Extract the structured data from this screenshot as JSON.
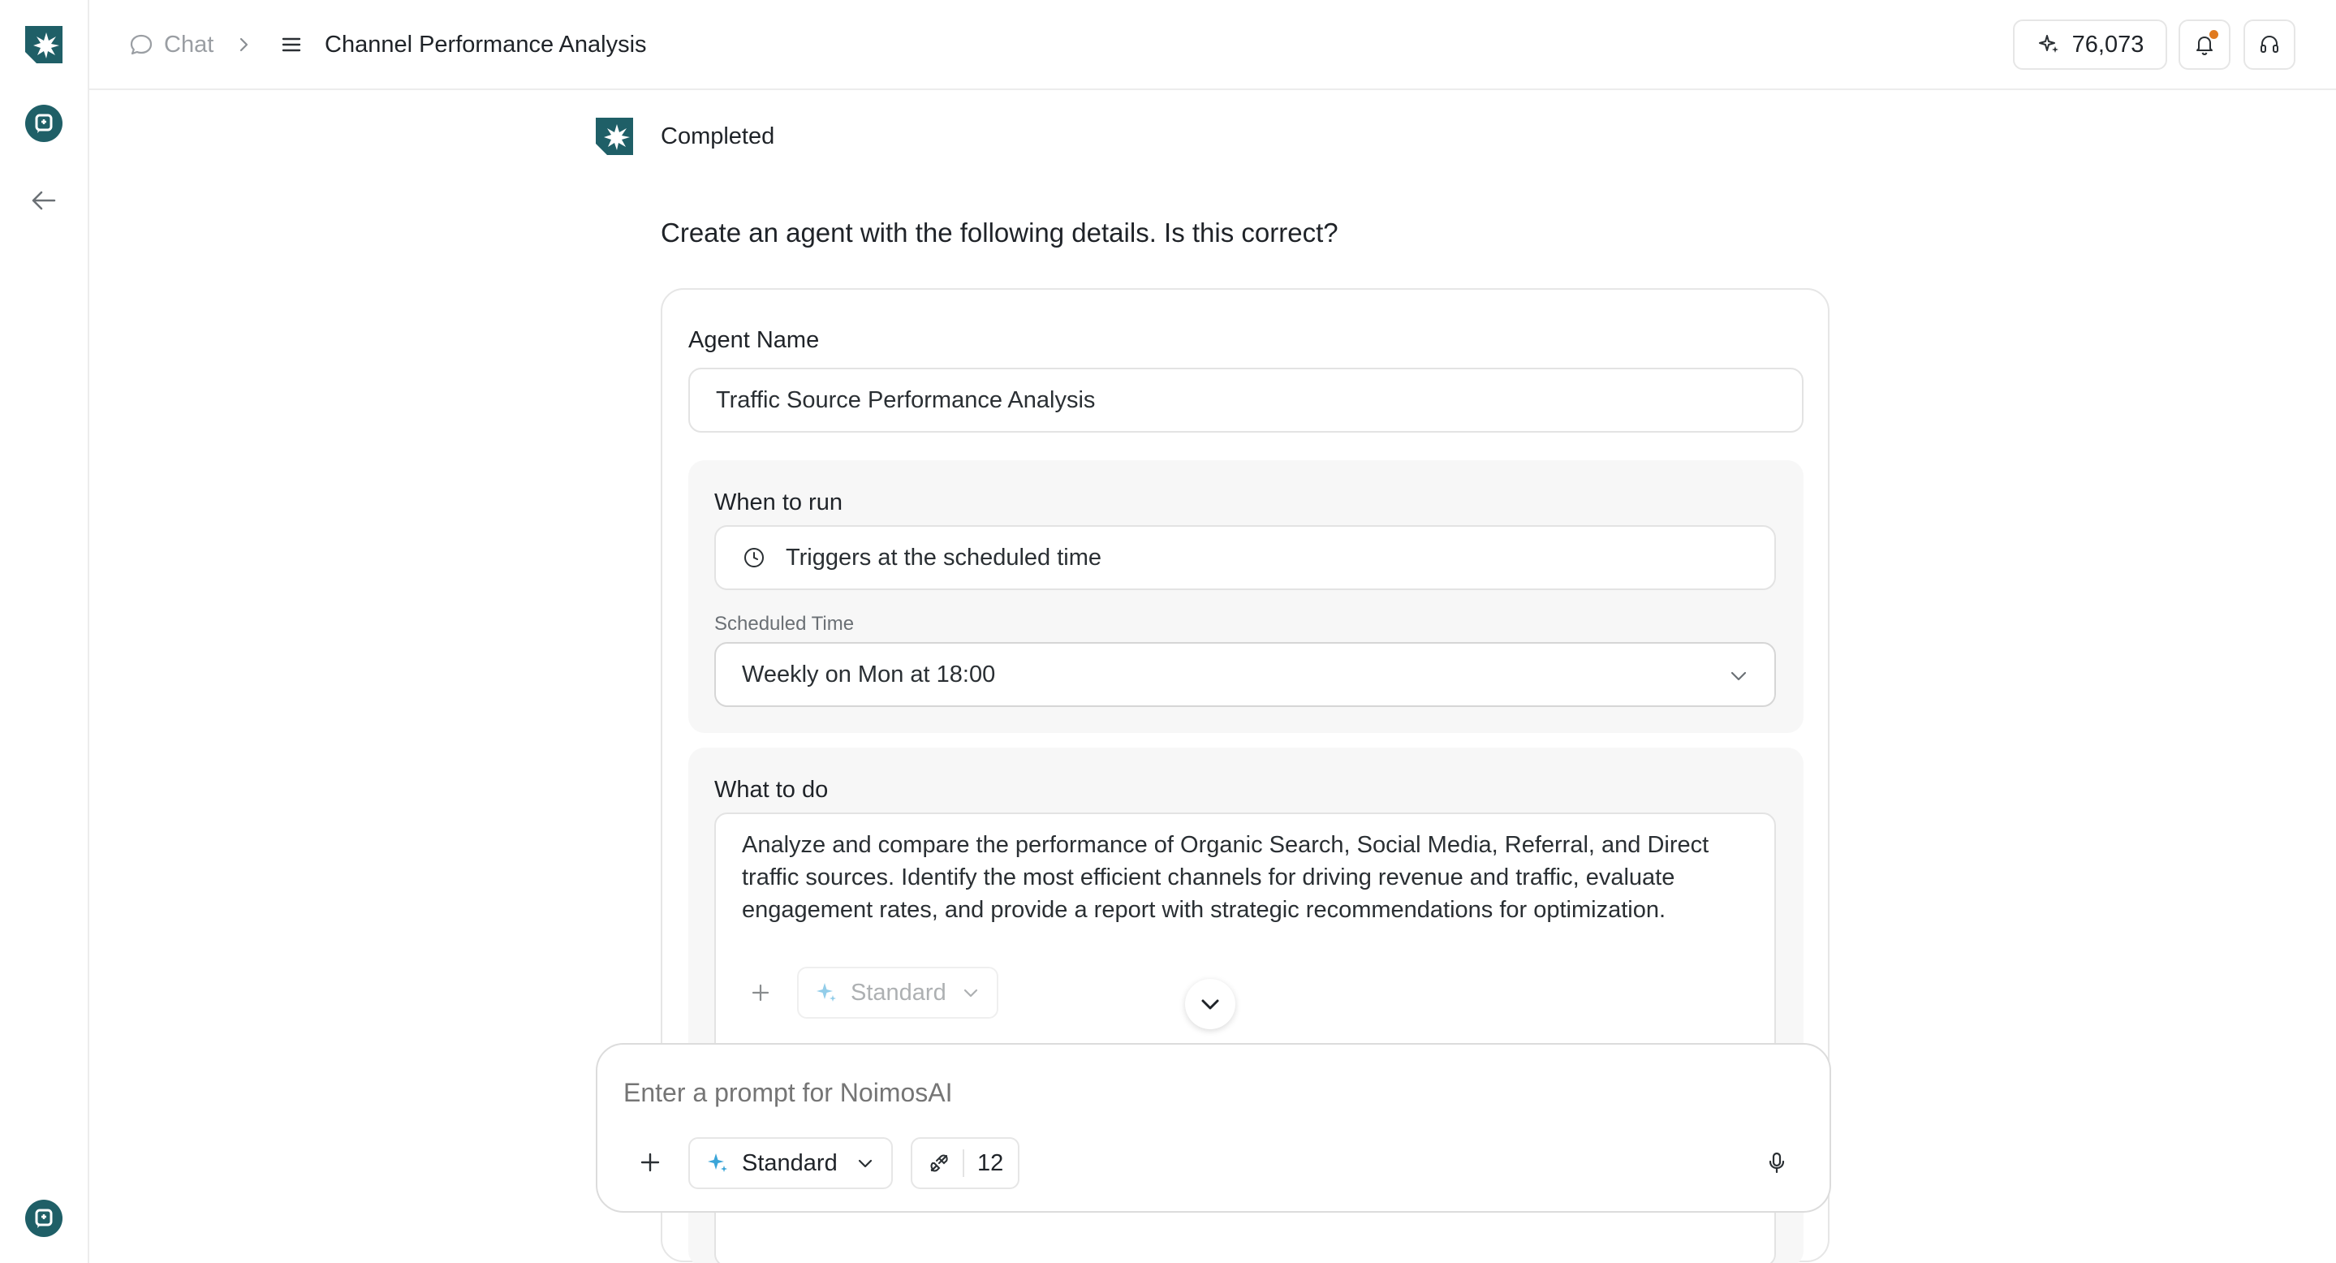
{
  "colors": {
    "brand": "#1f5f67",
    "accent_blue": "#3ba5d8",
    "notification_dot": "#e07a1f"
  },
  "sidebar": {
    "logo_icon": "noimos-logo-icon",
    "chat_icon": "chat-bubble-icon",
    "back_icon": "arrow-left-icon",
    "bottom_icon": "chat-bubble-icon"
  },
  "header": {
    "breadcrumb_root": "Chat",
    "breadcrumb_current": "Channel Performance Analysis",
    "credits": "76,073"
  },
  "message": {
    "status": "Completed",
    "question": "Create an agent with the following details. Is this correct?"
  },
  "agent_form": {
    "name_label": "Agent Name",
    "name_value": "Traffic Source Performance Analysis",
    "when_label": "When to run",
    "trigger_value": "Triggers at the scheduled time",
    "scheduled_label": "Scheduled Time",
    "scheduled_value": "Weekly on Mon at 18:00",
    "what_label": "What to do",
    "what_value": "Analyze and compare the performance of Organic Search, Social Media, Referral, and Direct traffic sources. Identify the most efficient channels for driving revenue and traffic, evaluate engagement rates, and provide a report with strategic recommendations for optimization.",
    "model_label": "Standard"
  },
  "composer": {
    "placeholder": "Enter a prompt for NoimosAI",
    "model_label": "Standard",
    "tools_count": "12"
  }
}
